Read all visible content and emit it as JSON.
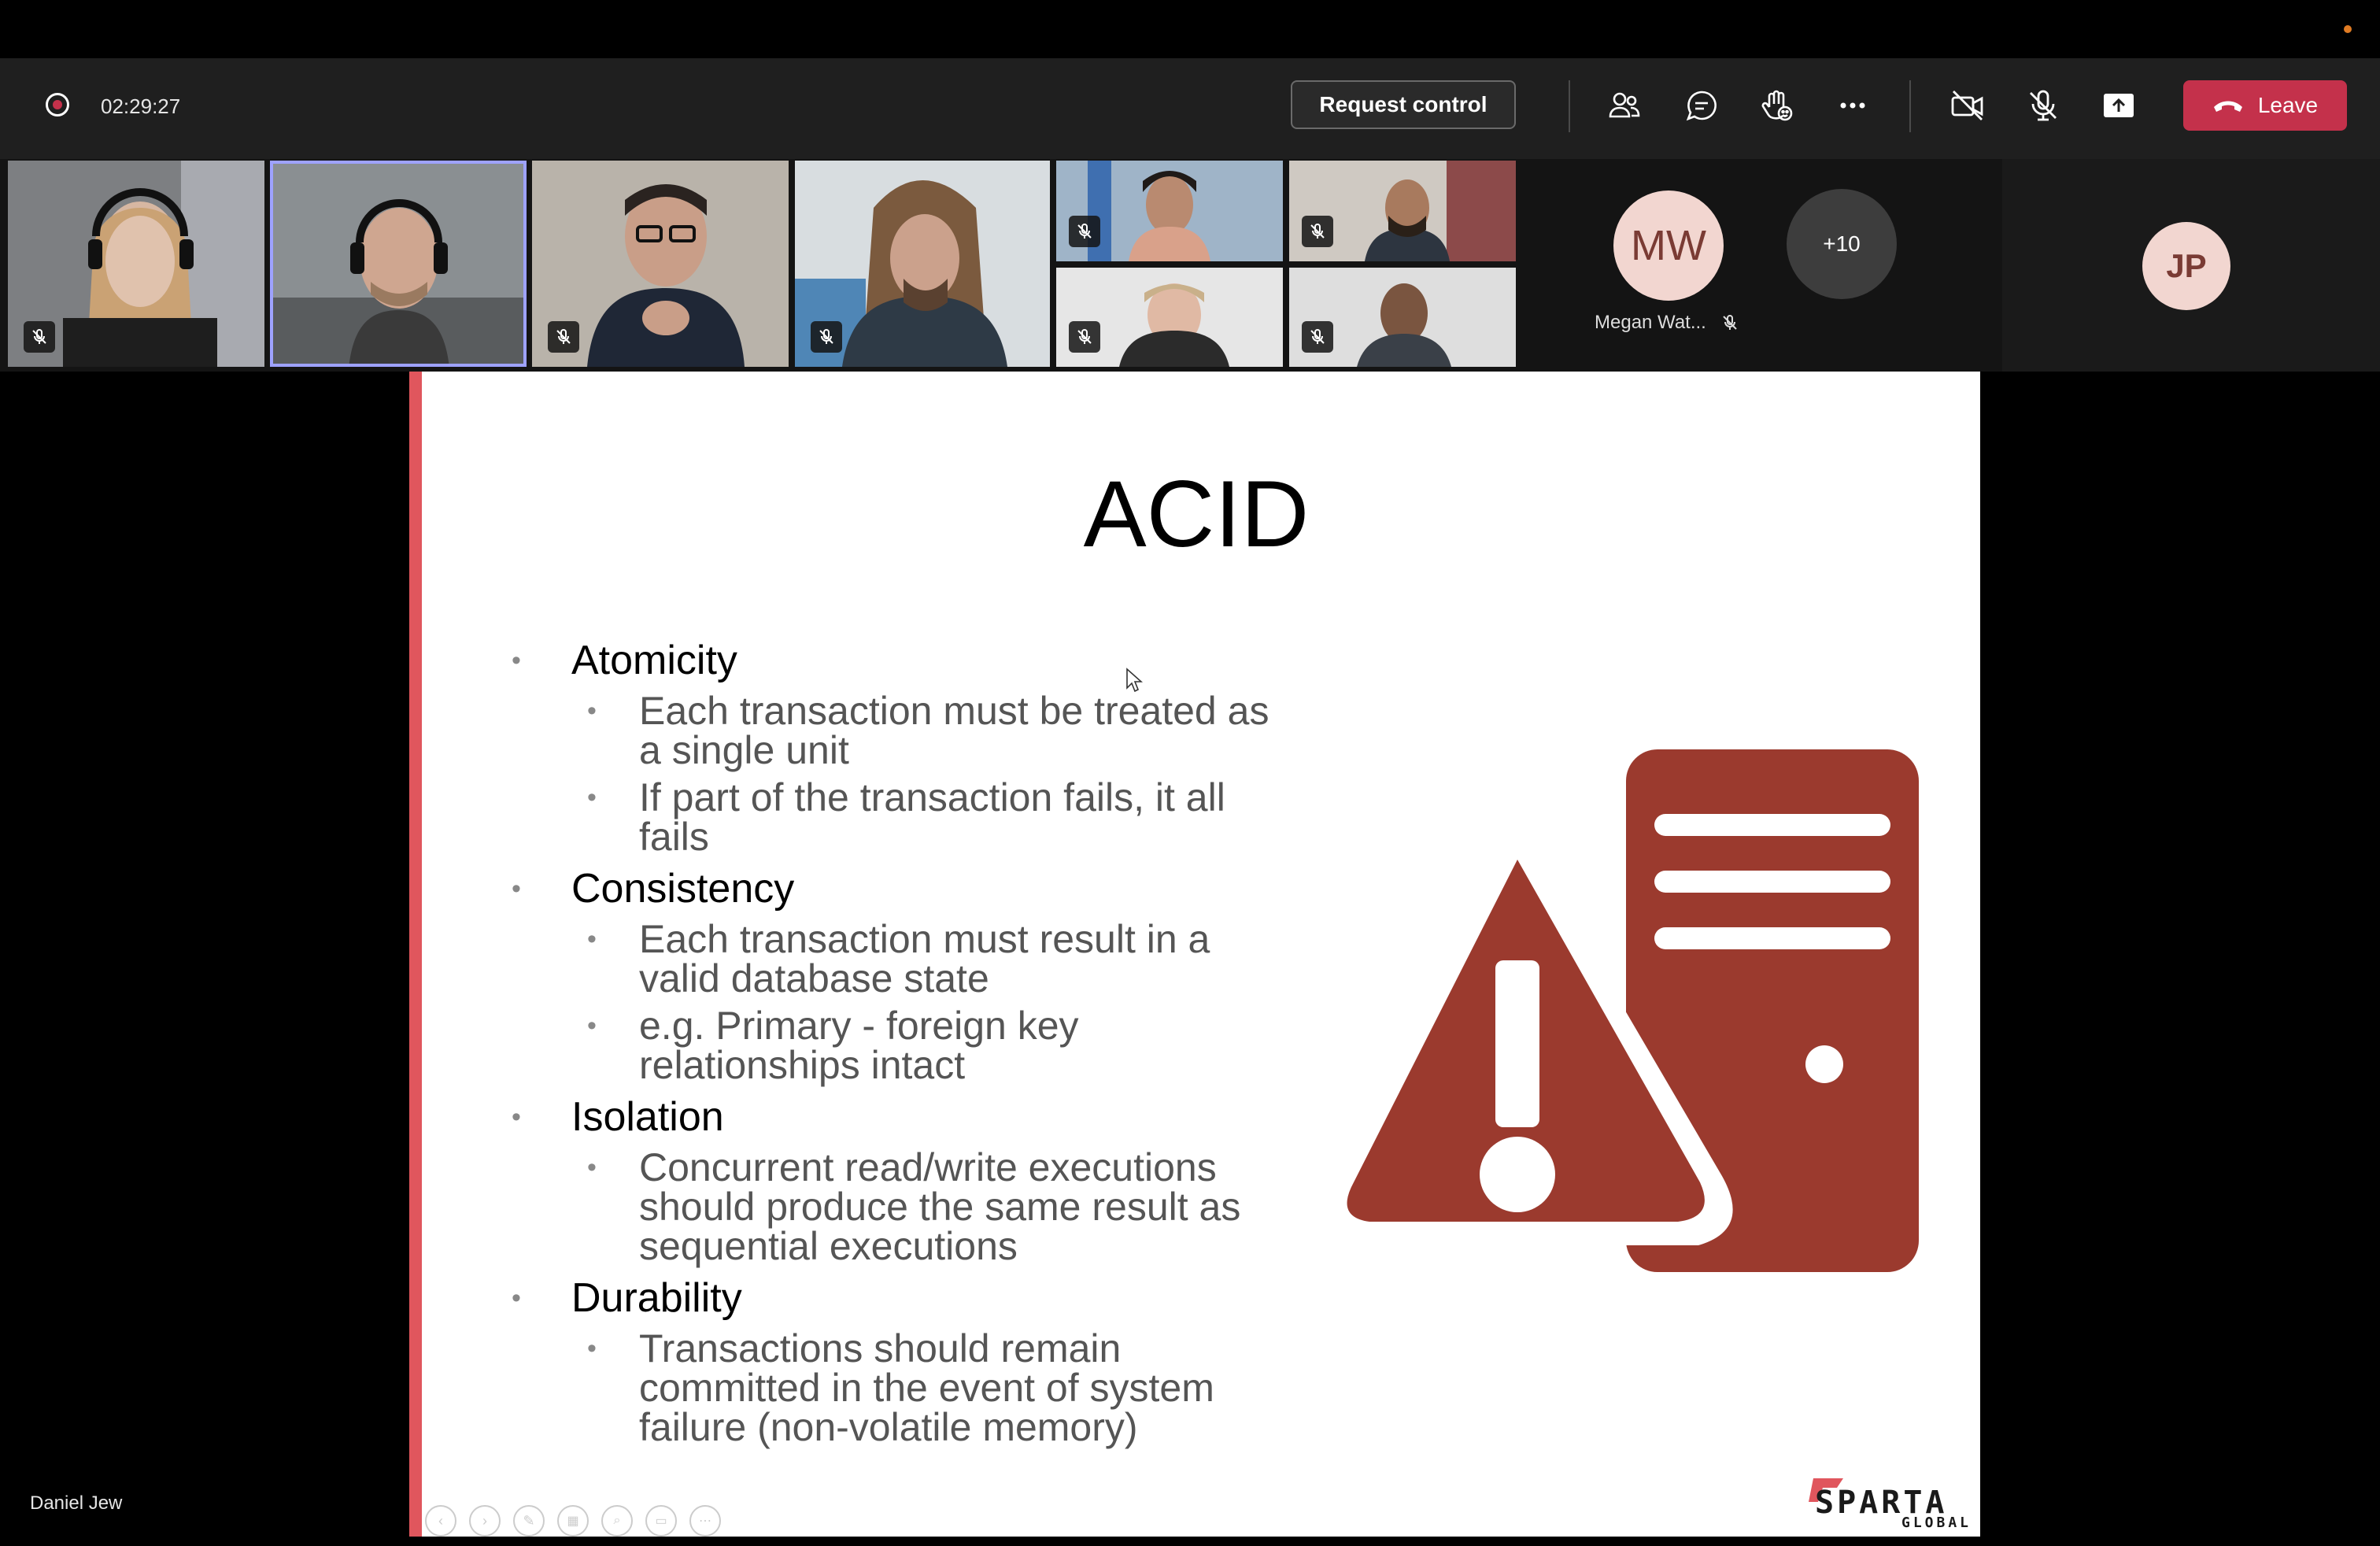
{
  "call": {
    "timer": "02:29:27",
    "request_control_label": "Request control",
    "leave_label": "Leave",
    "icons": [
      "participants-icon",
      "chat-icon",
      "reactions-icon",
      "more-icon",
      "camera-off-icon",
      "mic-off-icon",
      "share-icon"
    ]
  },
  "participants": {
    "mw_initials": "MW",
    "mw_name": "Megan Wat...",
    "overflow": "+10",
    "jp_initials": "JP"
  },
  "slide": {
    "title": "ACID",
    "sections": [
      {
        "heading": "Atomicity",
        "points": [
          "Each transaction must be treated as a single unit",
          "If part of the transaction fails, it all fails"
        ]
      },
      {
        "heading": "Consistency",
        "points": [
          "Each transaction must result in a valid database state",
          "e.g. Primary - foreign key relationships intact"
        ]
      },
      {
        "heading": "Isolation",
        "points": [
          "Concurrent read/write executions should produce the same result as sequential executions"
        ]
      },
      {
        "heading": "Durability",
        "points": [
          "Transactions should remain committed in the event of system failure (non-volatile memory)"
        ]
      }
    ],
    "logo_brand": "SPARTA",
    "logo_sub": "GLOBAL",
    "accent_color": "#9b3a2e"
  },
  "presenter_name": "Daniel Jew"
}
